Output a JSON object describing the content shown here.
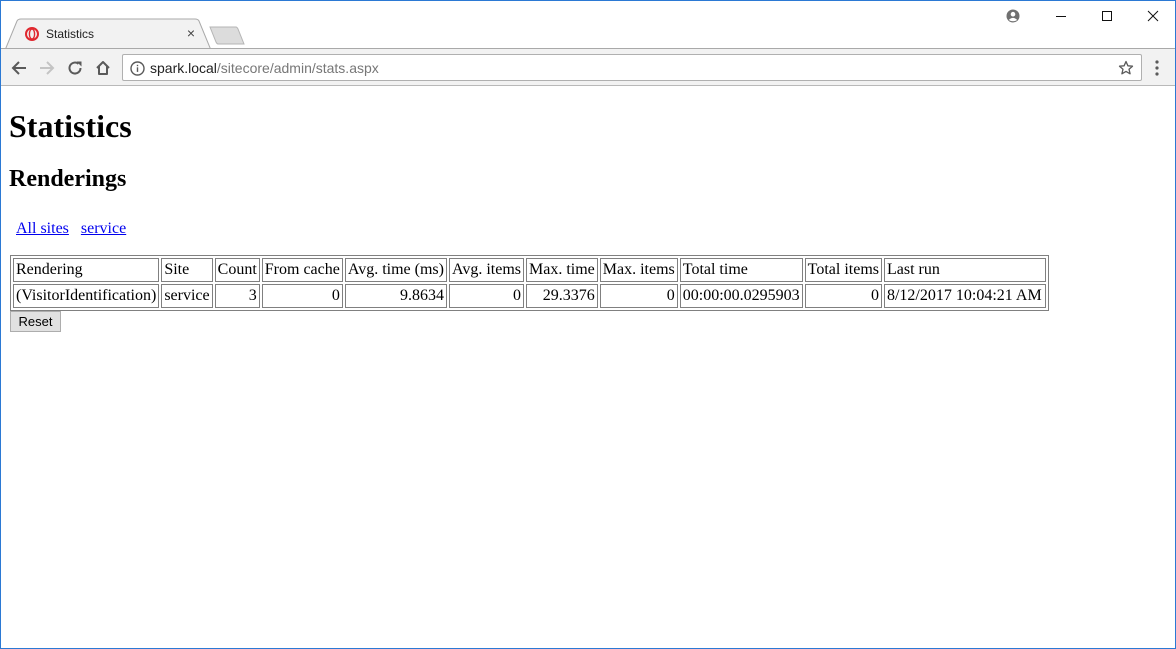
{
  "browser": {
    "tab": {
      "title": "Statistics",
      "favicon": "opera-o-icon",
      "close": "×"
    },
    "toolbar": {
      "url_host": "spark.local",
      "url_path": "/sitecore/admin/stats.aspx",
      "icons": [
        "back-arrow-icon",
        "forward-arrow-icon",
        "reload-icon",
        "home-icon",
        "info-icon",
        "bookmark-star-icon",
        "menu-kebab-icon"
      ]
    },
    "window_controls": [
      "profile-icon",
      "minimize-icon",
      "maximize-icon",
      "close-icon"
    ]
  },
  "page": {
    "title": "Statistics",
    "subtitle": "Renderings",
    "filter_links": [
      {
        "label": "All sites"
      },
      {
        "label": "service"
      }
    ],
    "table": {
      "headers": [
        "Rendering",
        "Site",
        "Count",
        "From cache",
        "Avg. time (ms)",
        "Avg. items",
        "Max. time",
        "Max. items",
        "Total time",
        "Total items",
        "Last run"
      ],
      "rows": [
        [
          "(VisitorIdentification)",
          "service",
          "3",
          "0",
          "9.8634",
          "0",
          "29.3376",
          "0",
          "00:00:00.0295903",
          "0",
          "8/12/2017 10:04:21 AM"
        ]
      ]
    },
    "reset_label": "Reset"
  },
  "colors": {
    "window_border": "#2b79d4",
    "toolbar_bg": "#f2f2f2",
    "link": "#0000ee",
    "favicon_red": "#e0282f"
  }
}
